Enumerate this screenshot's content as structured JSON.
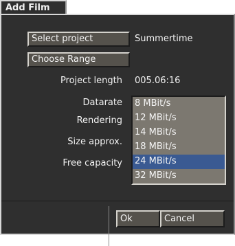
{
  "window": {
    "title": "Add Film"
  },
  "buttons": {
    "select_project": "Select project",
    "choose_range": "Choose Range",
    "ok": "Ok",
    "cancel": "Cancel"
  },
  "project": {
    "name": "Summertime"
  },
  "fields": {
    "project_length_label": "Project length",
    "project_length_value": "005.06:16",
    "datarate_label": "Datarate",
    "rendering_label": "Rendering",
    "size_label": "Size approx.",
    "free_capacity_label": "Free capacity"
  },
  "datarate_options": [
    "8 MBit/s",
    "12 MBit/s",
    "14 MBit/s",
    "18 MBit/s",
    "24 MBit/s",
    "32 MBit/s"
  ],
  "datarate_selected": "24 MBit/s",
  "colors": {
    "background": "#2f2f2f",
    "button": "#55524c",
    "list_background": "#7c7870",
    "selection": "#3a5a92"
  }
}
